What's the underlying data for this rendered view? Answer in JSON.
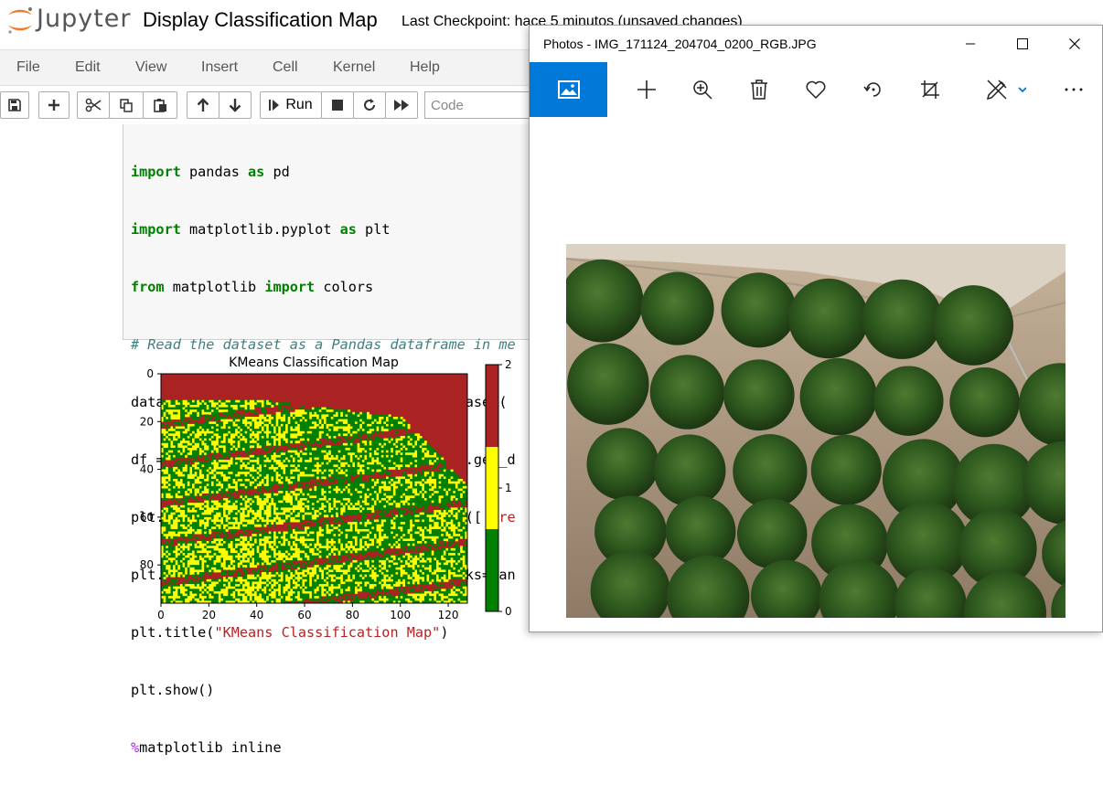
{
  "jupyter": {
    "logo_text": "Jupyter",
    "notebook_title": "Display Classification Map",
    "checkpoint": "Last Checkpoint: hace 5 minutos  (unsaved changes)",
    "menu": [
      "File",
      "Edit",
      "View",
      "Insert",
      "Cell",
      "Kernel",
      "Help"
    ],
    "toolbar": {
      "run_label": "Run",
      "cell_type": "Code",
      "icons": [
        "save-icon",
        "add-cell-icon",
        "cut-icon",
        "copy-icon",
        "paste-icon",
        "move-up-icon",
        "move-down-icon",
        "run-icon",
        "stop-icon",
        "restart-icon",
        "fast-forward-icon"
      ]
    },
    "code_lines": [
      "import pandas as pd",
      "import matplotlib.pyplot as plt",
      "from matplotlib import colors",
      "# Read the dataset as a Pandas dataframe in me",
      "dataset_Classification_Map = dataiku.Dataset(",
      "df = np.array(dataset_Classification_Map.get_d",
      "plt.imshow(df,cmap=colors.ListedColormap(['gre",
      "plt.colorbar(orientation ='vertical',ticks=ran",
      "plt.title(\"KMeans Classification Map\")",
      "plt.show()",
      "%matplotlib inline"
    ]
  },
  "chart_data": {
    "type": "heatmap",
    "title": "KMeans Classification Map",
    "xlabel": "",
    "ylabel": "",
    "x_ticks": [
      0,
      20,
      40,
      60,
      80,
      100,
      120
    ],
    "y_ticks": [
      0,
      20,
      40,
      60,
      80
    ],
    "xlim": [
      0,
      128
    ],
    "ylim": [
      96,
      0
    ],
    "colormap": [
      "#008000",
      "#ffff00",
      "#aa2222"
    ],
    "colorbar_ticks": [
      0,
      1,
      2
    ],
    "classes": [
      0,
      1,
      2
    ]
  },
  "photos": {
    "window_title": "Photos - IMG_171124_204704_0200_RGB.JPG",
    "toolbar_icons": [
      "view-photo-icon",
      "add-icon",
      "zoom-in-icon",
      "delete-icon",
      "favorite-icon",
      "rotate-icon",
      "crop-icon",
      "edit-icon",
      "more-icon"
    ],
    "accent_color": "#0078d7"
  }
}
